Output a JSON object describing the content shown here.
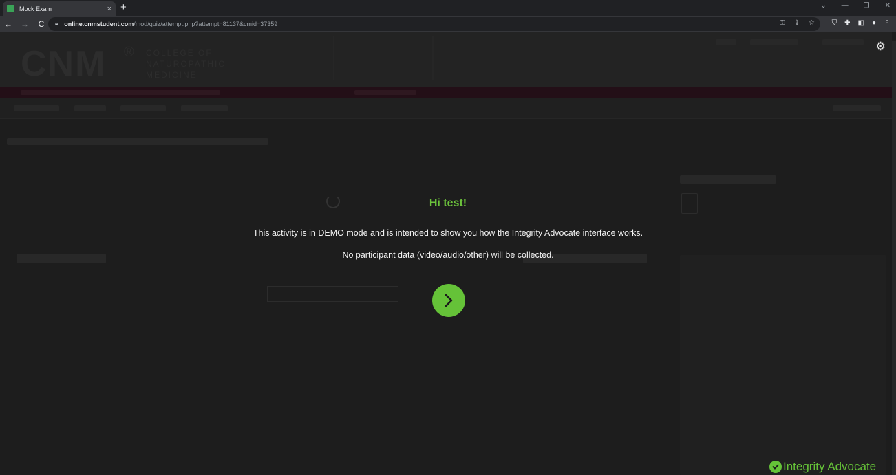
{
  "browser": {
    "tab_title": "Mock Exam",
    "tab_close": "×",
    "new_tab": "+",
    "back": "←",
    "forward": "→",
    "reload": "C",
    "url_host": "online.cnmstudent.com",
    "url_path": "/mod/quiz/attempt.php?attempt=81137&cmid=37359"
  },
  "header": {
    "logo_text": "CNM",
    "logo_reg": "®",
    "logo_tag_1": "COLLEGE OF",
    "logo_tag_2": "NATUROPATHIC",
    "logo_tag_3": "MEDICINE"
  },
  "modal": {
    "greeting": "Hi test!",
    "message_1": "This activity is in DEMO mode and is intended to show you how the Integrity Advocate interface works.",
    "message_2": "No participant data (video/audio/other) will be collected.",
    "brand": "Integrity Advocate"
  },
  "colors": {
    "accent": "#65c238",
    "overlay_bg": "#1d1d1d"
  },
  "icons": {
    "continue": "chevron-right-icon",
    "brand": "check-circle-icon",
    "settings": "gear-icon"
  }
}
